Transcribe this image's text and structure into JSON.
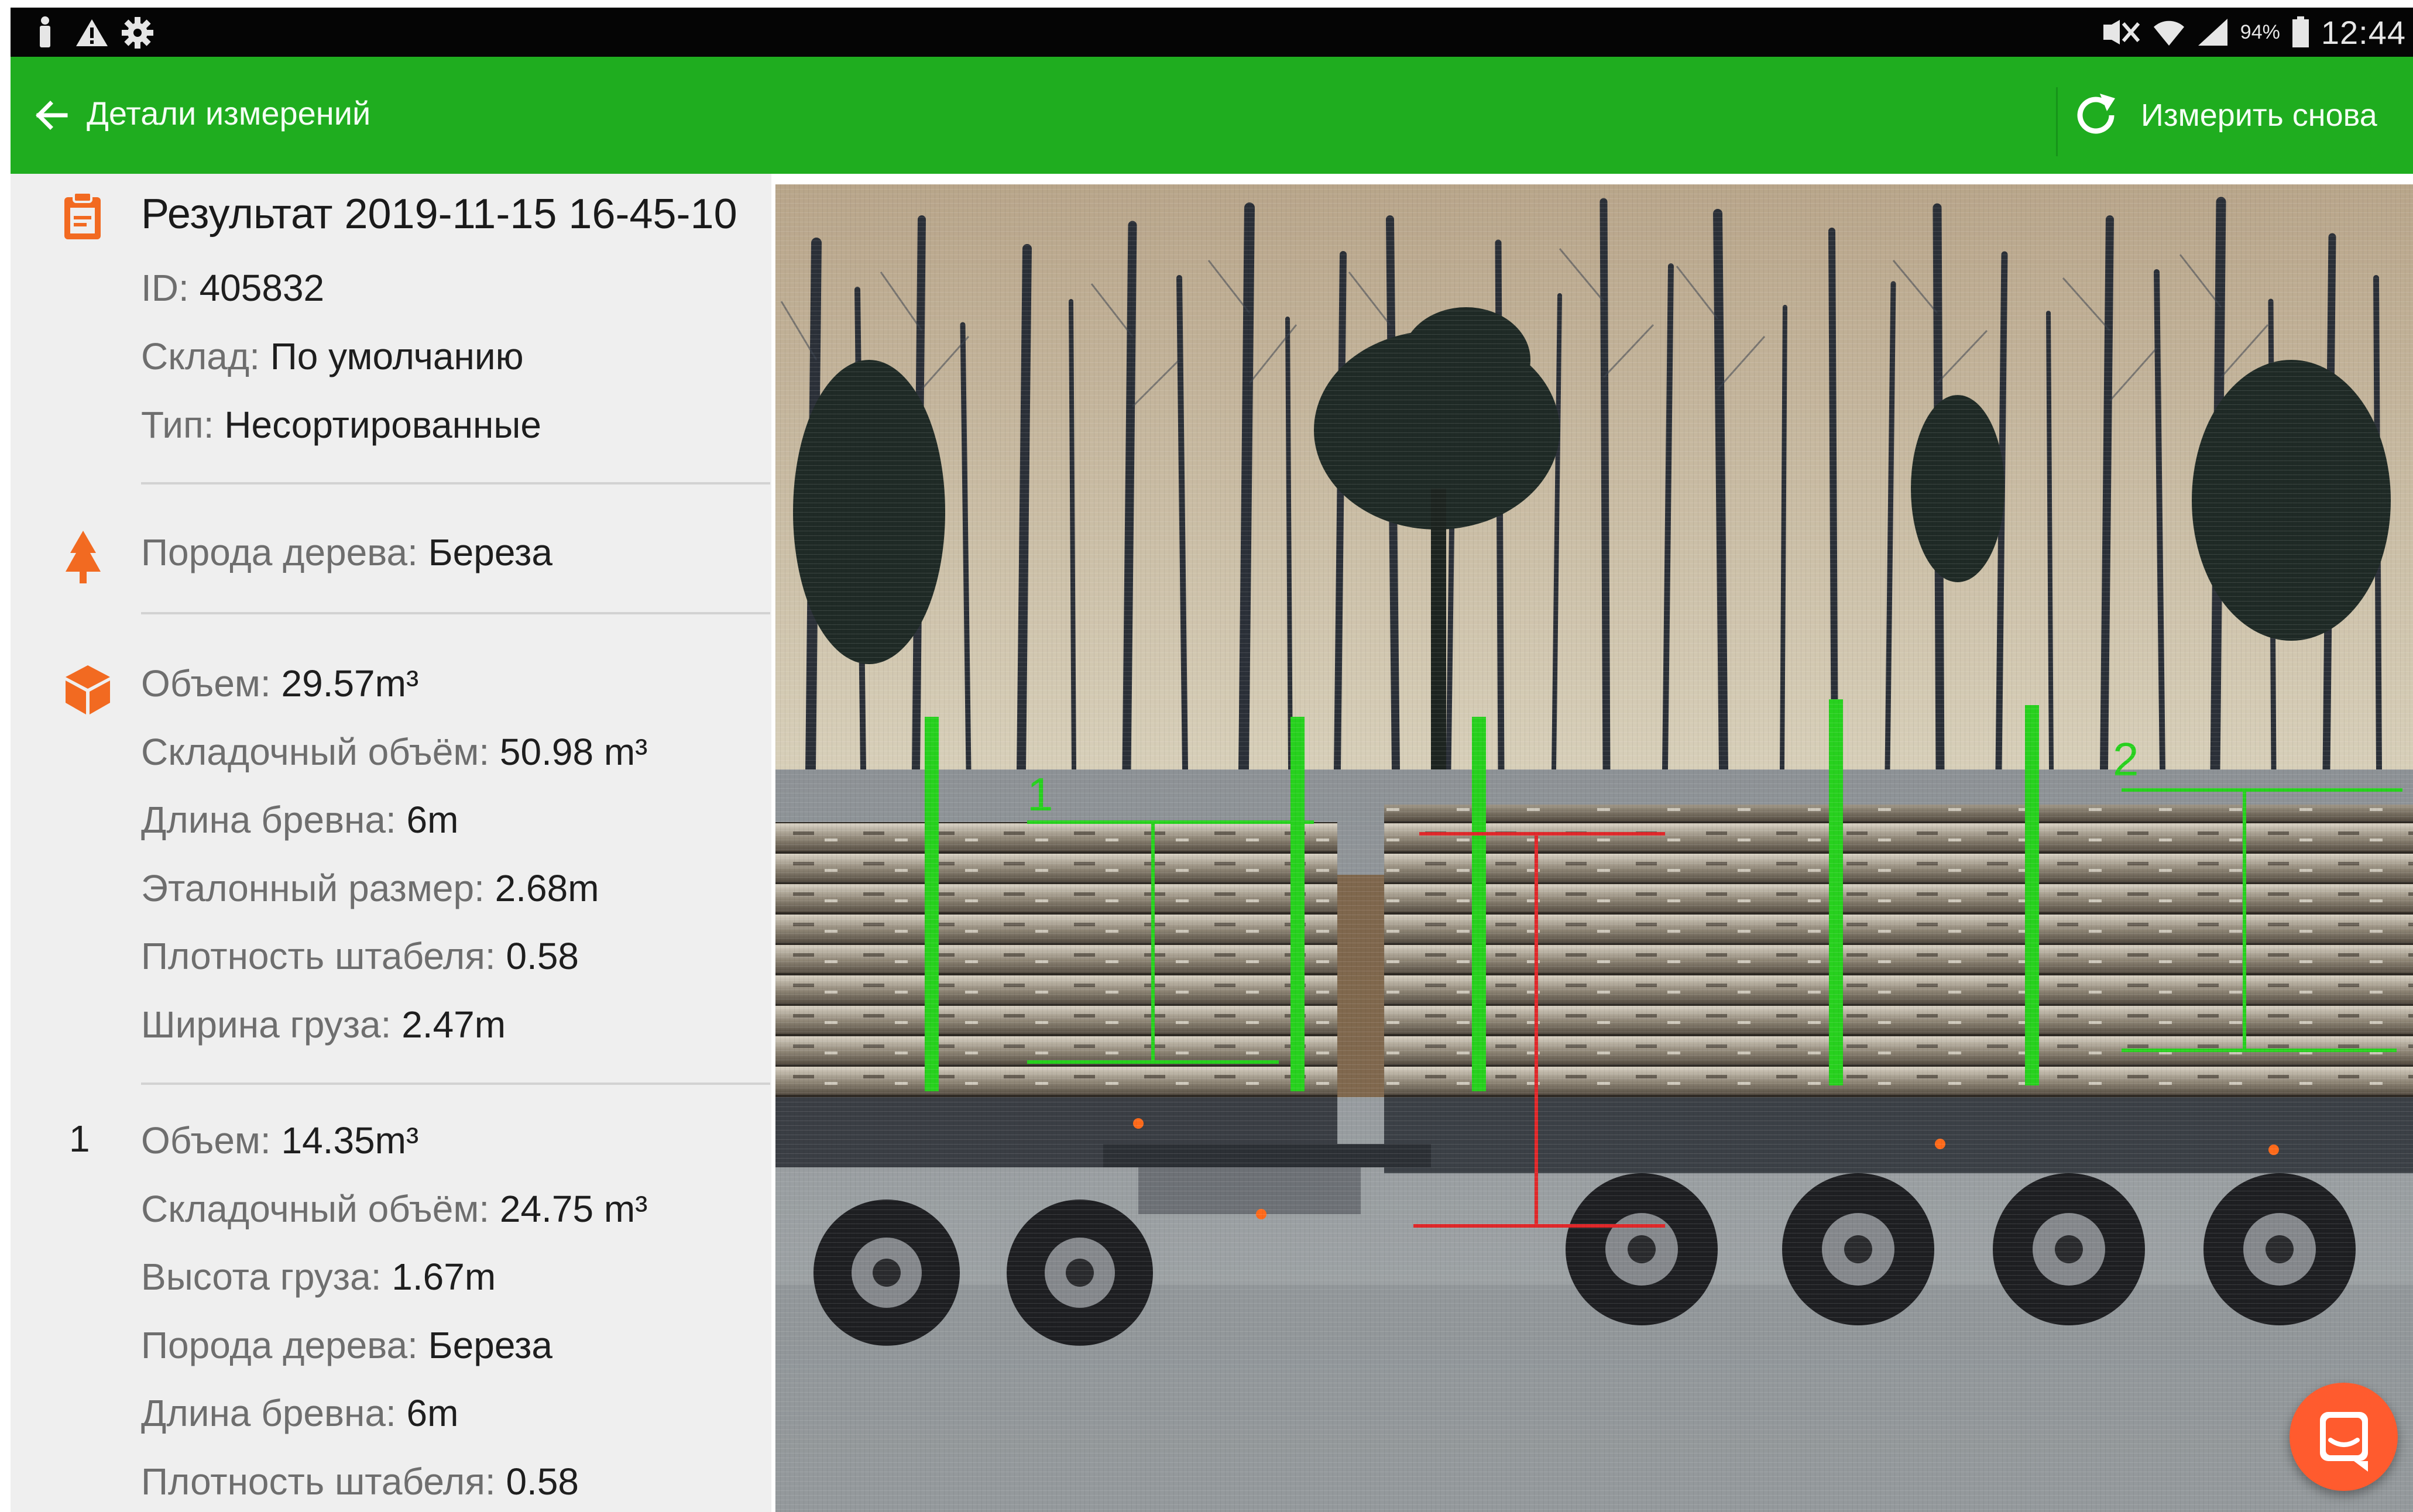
{
  "status_bar": {
    "battery_percent": "94%",
    "time": "12:44",
    "icons": [
      "person-icon",
      "warning-icon",
      "gear-icon",
      "mute-icon",
      "wifi-icon",
      "signal-icon",
      "battery-icon"
    ]
  },
  "app_bar": {
    "back_icon": "arrow-left-icon",
    "title": "Детали измерений",
    "retry_icon": "refresh-icon",
    "retry_label": "Измерить снова",
    "background_color": "#1fad1f"
  },
  "summary": {
    "icon": "clipboard-icon",
    "title": "Результат 2019-11-15 16-45-10",
    "id_label": "ID:",
    "id_value": "405832",
    "warehouse_label": "Склад:",
    "warehouse_value": "По умолчанию",
    "type_label": "Тип:",
    "type_value": "Несортированные"
  },
  "species": {
    "icon": "tree-icon",
    "label": "Порода дерева:",
    "value": "Береза"
  },
  "totals": {
    "icon": "cube-icon",
    "volume_label": "Объем:",
    "volume_value": "29.57m³",
    "stacked_volume_label": "Складочный объём:",
    "stacked_volume_value": "50.98 m³",
    "log_length_label": "Длина бревна:",
    "log_length_value": "6m",
    "reference_size_label": "Эталонный размер:",
    "reference_size_value": "2.68m",
    "stack_density_label": "Плотность штабеля:",
    "stack_density_value": "0.58",
    "load_width_label": "Ширина груза:",
    "load_width_value": "2.47m"
  },
  "group1": {
    "number": "1",
    "volume_label": "Объем:",
    "volume_value": "14.35m³",
    "stacked_volume_label": "Складочный объём:",
    "stacked_volume_value": "24.75 m³",
    "load_height_label": "Высота груза:",
    "load_height_value": "1.67m",
    "species_label": "Порода дерева:",
    "species_value": "Береза",
    "log_length_label": "Длина бревна:",
    "log_length_value": "6m",
    "stack_density_label": "Плотность штабеля:",
    "stack_density_value": "0.58"
  },
  "photo": {
    "marker_1": "1",
    "marker_2": "2",
    "marker_color": "#27d11e",
    "reference_color": "#e0282a"
  },
  "accent_color": "#f26a21",
  "chat_button": {
    "icon": "chat-icon",
    "color": "#ff5b2e"
  }
}
